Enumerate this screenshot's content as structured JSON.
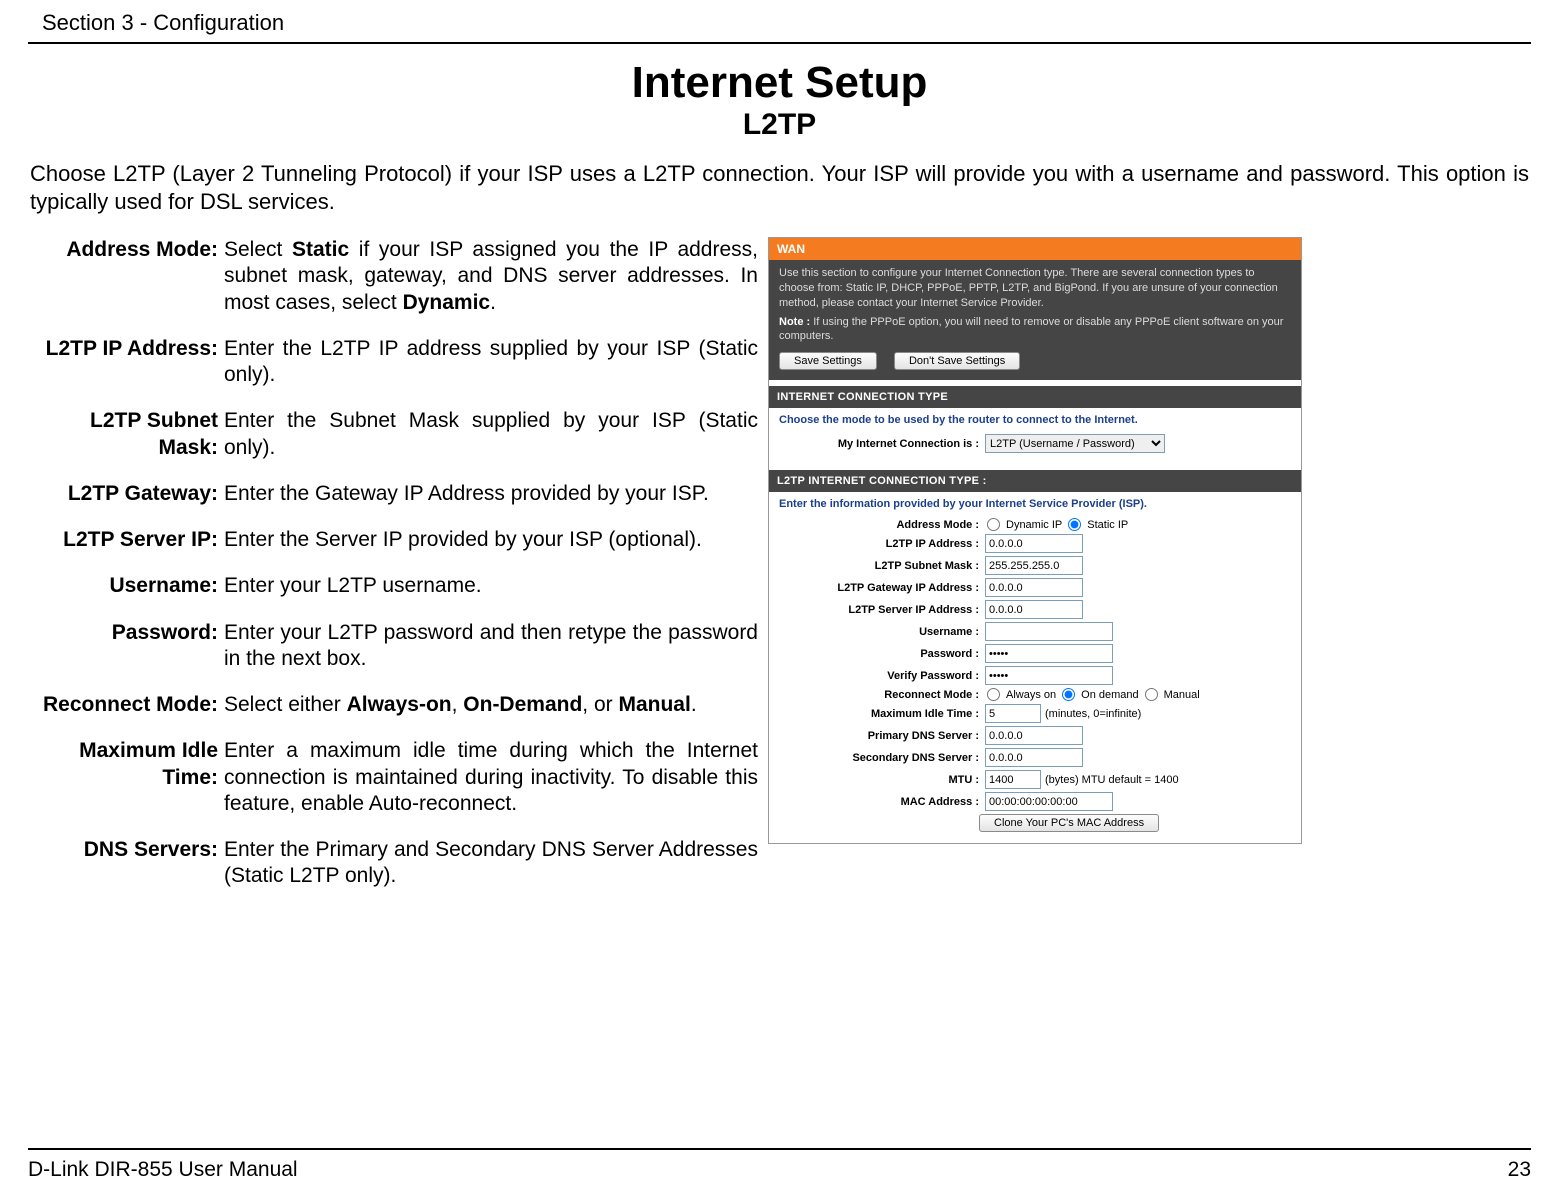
{
  "header_section": "Section 3 - Configuration",
  "title": "Internet Setup",
  "subtitle": "L2TP",
  "intro": "Choose L2TP (Layer 2 Tunneling Protocol) if your ISP uses a L2TP connection. Your ISP will provide you with a username and password. This option is typically used for DSL services.",
  "defs": {
    "address_mode": {
      "label": "Address Mode:",
      "pre": "Select ",
      "b1": "Static",
      "mid": " if your ISP assigned you the IP address, subnet mask, gateway, and DNS server addresses. In most cases, select ",
      "b2": "Dynamic",
      "post": "."
    },
    "ip": {
      "label": "L2TP IP Address:",
      "val": "Enter the L2TP IP address supplied by your ISP (Static only)."
    },
    "mask": {
      "label": "L2TP Subnet Mask:",
      "val": "Enter the Subnet Mask supplied by your ISP (Static only)."
    },
    "gw": {
      "label": "L2TP Gateway:",
      "val": "Enter the Gateway IP Address provided by your ISP."
    },
    "server": {
      "label": "L2TP Server IP:",
      "val": "Enter the Server IP provided by your ISP (optional)."
    },
    "user": {
      "label": "Username:",
      "val": "Enter your L2TP username."
    },
    "pass": {
      "label": "Password:",
      "val": "Enter your L2TP password and then retype the password in the next box."
    },
    "reconnect": {
      "label": "Reconnect Mode:",
      "pre": "Select either ",
      "b1": "Always-on",
      "sep1": ", ",
      "b2": "On-Demand",
      "sep2": ", or ",
      "b3": "Manual",
      "post": "."
    },
    "idle": {
      "label": "Maximum Idle Time:",
      "val": "Enter a maximum idle time during which the Internet connection is maintained during inactivity. To disable this feature, enable Auto-reconnect."
    },
    "dns": {
      "label": "DNS Servers:",
      "val": "Enter the Primary and Secondary DNS Server Addresses (Static L2TP only)."
    }
  },
  "shot": {
    "wan_title": "WAN",
    "wan_desc": "Use this section to configure your Internet Connection type. There are several connection types to choose from: Static IP, DHCP, PPPoE, PPTP, L2TP, and BigPond. If you are unsure of your connection method, please contact your Internet Service Provider.",
    "wan_note_label": "Note :",
    "wan_note": " If using the PPPoE option, you will need to remove or disable any PPPoE client software on your computers.",
    "btn_save": "Save Settings",
    "btn_dont": "Don't Save Settings",
    "ict_title": "INTERNET CONNECTION TYPE",
    "ict_desc": "Choose the mode to be used by the router to connect to the Internet.",
    "ict_label": "My Internet Connection is :",
    "ict_value": "L2TP (Username / Password)",
    "l2tp_title": "L2TP INTERNET CONNECTION TYPE :",
    "l2tp_desc": "Enter the information provided by your Internet Service Provider (ISP).",
    "labels": {
      "address_mode": "Address Mode :",
      "ip": "L2TP IP Address :",
      "mask": "L2TP Subnet Mask :",
      "gw": "L2TP Gateway IP Address :",
      "server": "L2TP Server IP Address :",
      "user": "Username :",
      "pass": "Password :",
      "verify": "Verify Password :",
      "reconnect": "Reconnect Mode :",
      "idle": "Maximum Idle Time :",
      "pdns": "Primary DNS Server :",
      "sdns": "Secondary DNS Server :",
      "mtu": "MTU :",
      "mac": "MAC Address :"
    },
    "radios": {
      "dynamic": "Dynamic IP",
      "static": "Static IP",
      "always": "Always on",
      "ondemand": "On demand",
      "manual": "Manual"
    },
    "values": {
      "ip": "0.0.0.0",
      "mask": "255.255.255.0",
      "gw": "0.0.0.0",
      "server": "0.0.0.0",
      "user": "",
      "pass": "•••••",
      "verify": "•••••",
      "idle": "5",
      "idle_hint": "(minutes, 0=infinite)",
      "pdns": "0.0.0.0",
      "sdns": "0.0.0.0",
      "mtu": "1400",
      "mtu_hint": "(bytes) MTU default = 1400",
      "mac": "00:00:00:00:00:00"
    },
    "btn_clone": "Clone Your PC's MAC Address"
  },
  "footer_left": "D-Link DIR-855 User Manual",
  "footer_right": "23"
}
